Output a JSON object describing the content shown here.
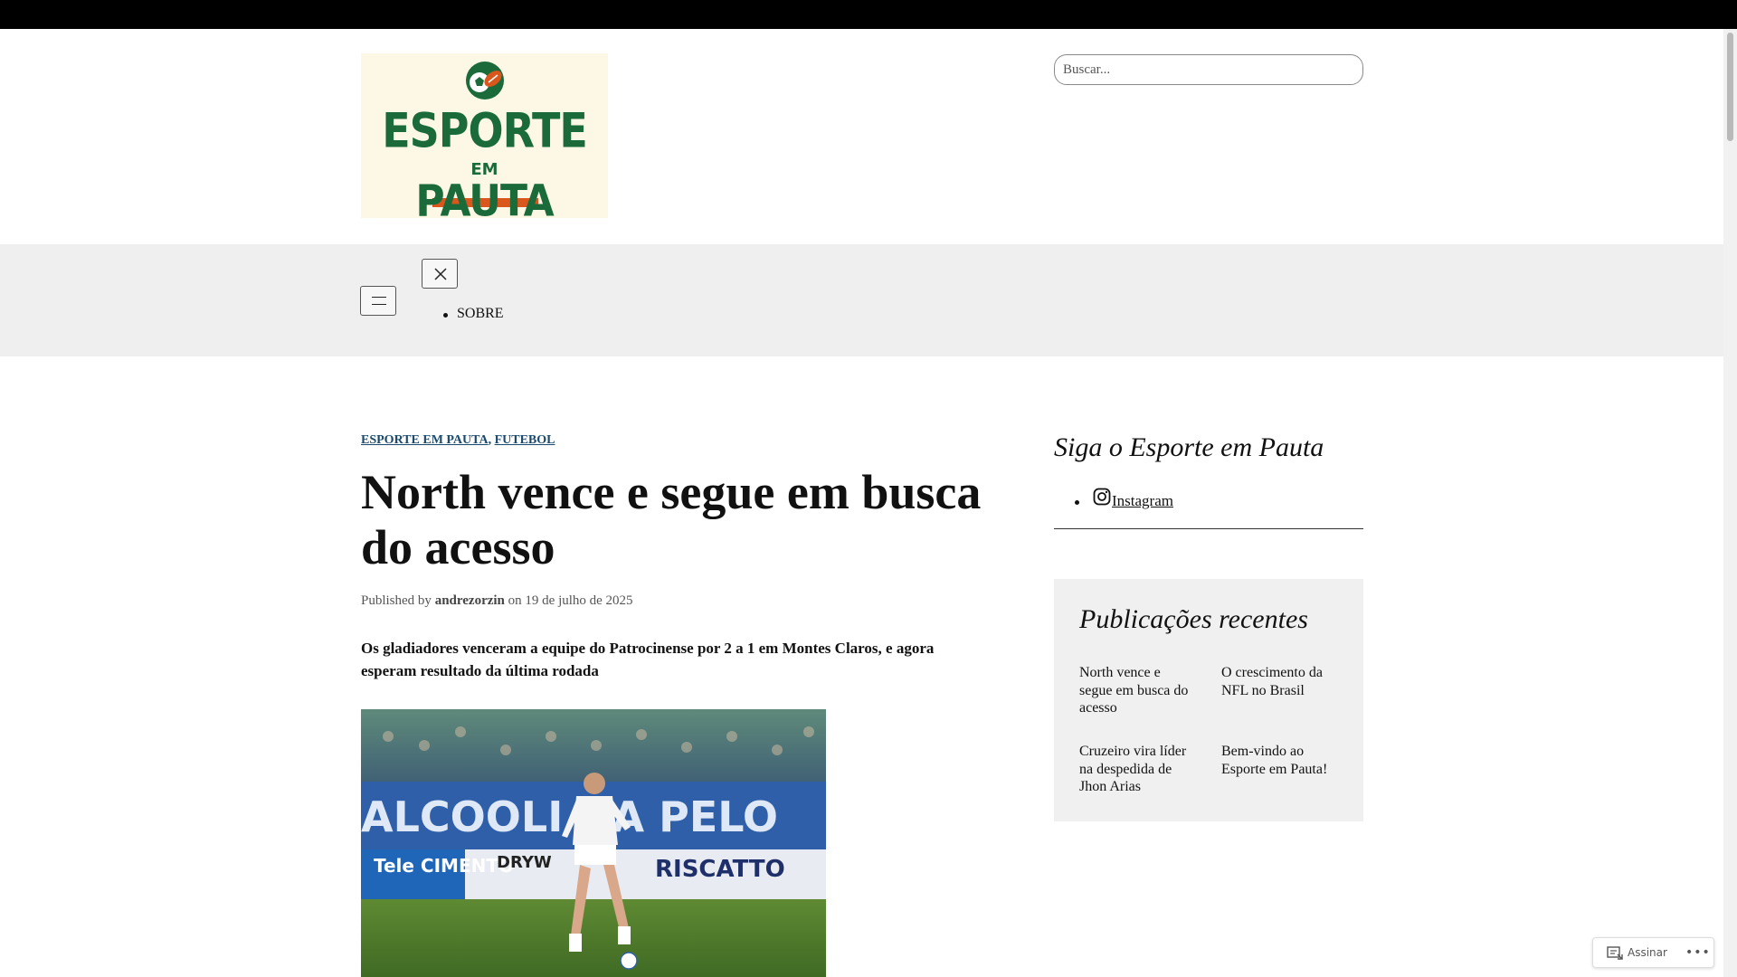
{
  "site": {
    "logo": {
      "line1": "ESPORTE",
      "line2": "EM",
      "line3": "PAUTA"
    }
  },
  "search": {
    "placeholder": "Buscar..."
  },
  "nav": {
    "items": [
      {
        "label": "SOBRE"
      }
    ]
  },
  "post": {
    "categories": [
      "ESPORTE EM PAUTA",
      "FUTEBOL"
    ],
    "category_separator": ",",
    "title": "North vence e segue em busca do acesso",
    "byline_prefix": "Published by",
    "author": "andrezorzin",
    "byline_on": "on",
    "date": "19 de julho de 2025",
    "excerpt": "Os gladiadores venceram a equipe do Patrocinense por 2 a 1 em Montes Claros, e agora esperam resultado da última rodada",
    "image_banners": {
      "wall": "ALCOOLI DA PELO",
      "ad_left": "Tele CIMENTO",
      "ad_right": "RISCATTO",
      "ad_mid": "DRYW"
    }
  },
  "sidebar": {
    "social_title": "Siga o Esporte em Pauta",
    "social_links": [
      {
        "label": "Instagram",
        "icon": "instagram-icon"
      }
    ],
    "recent_title": "Publicações recentes",
    "recent_posts": [
      "North vence e segue em busca do acesso",
      "O crescimento da NFL no Brasil",
      "Cruzeiro vira líder na despedida de Jhon Arias",
      "Bem-vindo ao Esporte em Pauta!"
    ]
  },
  "subscribe": {
    "label": "Assinar",
    "more": "•••"
  },
  "colors": {
    "topbar": "#000000",
    "nav_band": "#efefef",
    "link_category": "#1a4a6e",
    "logo_green": "#1b6b3a",
    "logo_orange": "#d9571c",
    "logo_bg": "#fdf8e6",
    "recent_bg": "#f0f0f0"
  }
}
